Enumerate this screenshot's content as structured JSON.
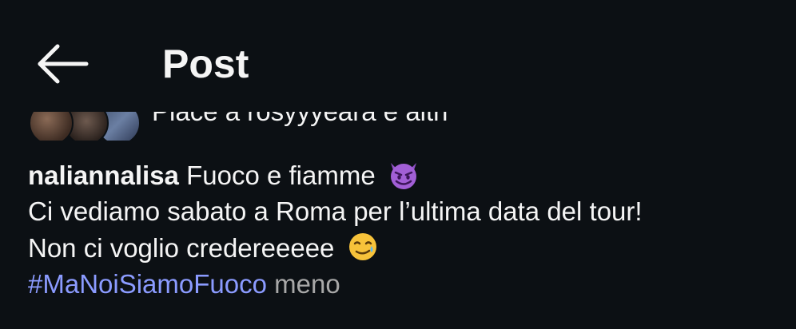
{
  "header": {
    "back_icon": "arrow-left-icon",
    "title": "Post"
  },
  "likes": {
    "text": "Piace a rosyyyeara e altri",
    "avatars": [
      "avatar-1",
      "avatar-2",
      "avatar-3"
    ]
  },
  "caption": {
    "username": "naliannalisa",
    "line1_text": "Fuoco e fiamme",
    "line1_emoji": "smiling-imp-emoji",
    "line2": "Ci vediamo sabato a Roma per l’ultima data del tour!",
    "line3_text": "Non ci voglio credereeeee",
    "line3_emoji": "smiling-face-with-tear-emoji",
    "hashtag": "#MaNoiSiamoFuoco",
    "less_label": "meno"
  },
  "colors": {
    "background": "#0c1014",
    "text": "#f5f5f5",
    "hashtag": "#8b9bff",
    "muted": "#a8a8a8",
    "emoji_purple": "#a25fd6"
  }
}
